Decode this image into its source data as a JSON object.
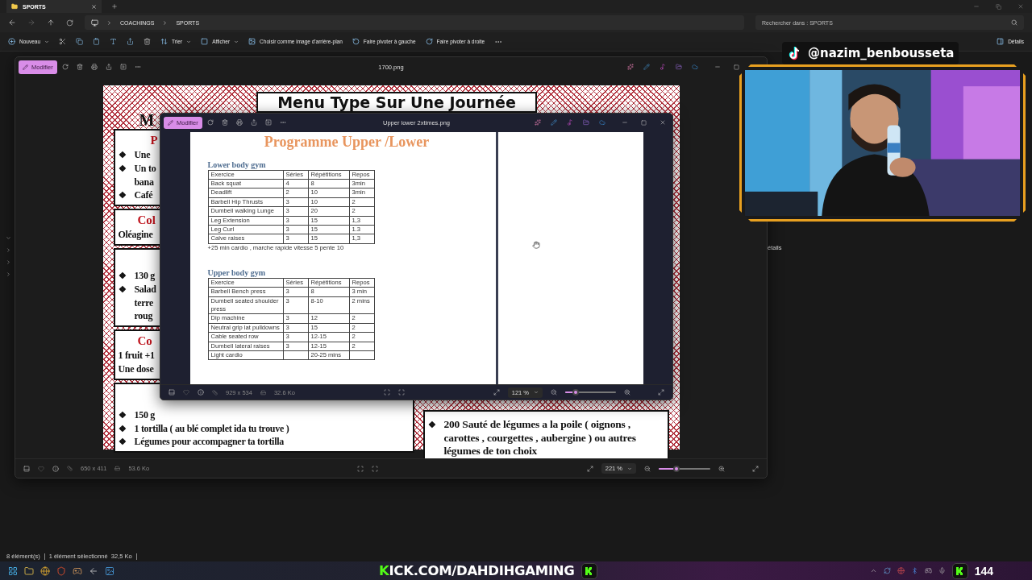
{
  "explorer": {
    "tab": {
      "title": "SPORTS"
    },
    "breadcrumb": [
      "COACHINGS",
      "SPORTS"
    ],
    "search": {
      "placeholder": "Rechercher dans : SPORTS"
    },
    "commands": [
      {
        "kind": "dropdown",
        "label": "Nouveau"
      },
      {
        "kind": "dropdown",
        "label": "Trier"
      },
      {
        "kind": "dropdown",
        "label": "Afficher"
      },
      {
        "kind": "action",
        "label": "Choisir comme image d'arrière-plan"
      },
      {
        "kind": "action",
        "label": "Faire pivoter à gauche"
      },
      {
        "kind": "action",
        "label": "Faire pivoter à droite"
      }
    ],
    "details_button": "Détails",
    "details_pane_fragment": "étails",
    "status_bar": {
      "item_count": "8 élément(s)",
      "selection": "1 élément sélectionné  32,5 Ko"
    }
  },
  "viewer_back": {
    "edit_button": "Modifier",
    "file_name": "1700.png",
    "dimensions": "650 x 411",
    "file_size": "53.6 Ko",
    "zoom": "221 %",
    "zoom_slider": {
      "level": 0.35
    },
    "menu_image": {
      "title": "Menu Type Sur Une Journée",
      "side_heading": "M",
      "cards": [
        {
          "lines": [
            {
              "kind": "heading",
              "text": "P"
            },
            {
              "kind": "bullet",
              "bullet": "❖",
              "text": "Une"
            },
            {
              "kind": "bullet",
              "bullet": "❖",
              "text": "Un to"
            },
            {
              "kind": "continuation",
              "text": "bana"
            },
            {
              "kind": "bullet",
              "bullet": "❖",
              "text": "Café"
            }
          ]
        },
        {
          "lines": [
            {
              "kind": "heading",
              "text": "Col"
            },
            {
              "kind": "plain",
              "text": "Oléagine"
            }
          ]
        },
        {
          "lines": [
            {
              "kind": "bullet",
              "bullet": "❖",
              "text": "130 g"
            },
            {
              "kind": "bullet",
              "bullet": "❖",
              "text": "Salad"
            },
            {
              "kind": "continuation",
              "text": "terre"
            },
            {
              "kind": "continuation",
              "text": "roug"
            }
          ]
        },
        {
          "lines": [
            {
              "kind": "heading",
              "text": "Co"
            },
            {
              "kind": "plain",
              "text": "1 fruit +1"
            },
            {
              "kind": "plain",
              "text": "Une dose"
            }
          ]
        },
        {
          "lines": [
            {
              "kind": "bullet",
              "bullet": "❖",
              "text": "150 g"
            },
            {
              "kind": "bullet",
              "bullet": "❖",
              "text": "1 tortilla ( au blé complet  ida tu trouve )"
            },
            {
              "kind": "bullet",
              "bullet": "❖",
              "text": "Légumes pour accompagner ta tortilla"
            }
          ]
        }
      ],
      "right_card": {
        "lines": [
          {
            "kind": "bullet",
            "bullet": "❖",
            "text": "200 Sauté de légumes a la poile ( oignons , carottes , courgettes , aubergine ) ou autres légumes de ton  choix"
          }
        ]
      }
    }
  },
  "viewer_front": {
    "edit_button": "Modifier",
    "file_name": "Upper lower 2xtimes.png",
    "dimensions": "929 x 534",
    "file_size": "32.6 Ko",
    "zoom": "121 %",
    "zoom_slider": {
      "level": 0.2
    },
    "document": {
      "title": "Programme Upper /Lower",
      "sections": [
        {
          "heading": "Lower body gym",
          "columns": [
            "Exercice",
            "Séries",
            "Répétitions",
            "Repos"
          ],
          "rows": [
            {
              "exercise": "Back squat",
              "sets": "4",
              "reps": "8",
              "rest": "3min"
            },
            {
              "exercise": "Deadlift",
              "sets": "2",
              "reps": "10",
              "rest": "3min"
            },
            {
              "exercise": "Barbell Hip Thrusts",
              "sets": "3",
              "reps": "10",
              "rest": "2"
            },
            {
              "exercise": "Dumbell walking Lunge",
              "sets": "3",
              "reps": "20",
              "rest": "2"
            },
            {
              "exercise": "Leg Extension",
              "sets": "3",
              "reps": "15",
              "rest": "1,3"
            },
            {
              "exercise": "Leg Curl",
              "sets": "3",
              "reps": "15",
              "rest": "1.3"
            },
            {
              "exercise": "Calve raises",
              "sets": "3",
              "reps": "15",
              "rest": "1,3"
            }
          ],
          "note": "+25 min cardio , marche rapide vitesse 5 pente 10"
        },
        {
          "heading": "Upper body gym",
          "columns": [
            "Exercice",
            "Séries",
            "Répétitions",
            "Repos"
          ],
          "rows": [
            {
              "exercise": "Barbell Bench press",
              "sets": "3",
              "reps": "8",
              "rest": "3 min"
            },
            {
              "exercise": "Dumbell seated shoulder press",
              "sets": "3",
              "reps": "8-10",
              "rest": "2 mins"
            },
            {
              "exercise": "Dip machine",
              "sets": "3",
              "reps": "12",
              "rest": "2"
            },
            {
              "exercise": "Neutral grip lat pulldowns",
              "sets": "3",
              "reps": "15",
              "rest": "2"
            },
            {
              "exercise": "Cable seated row",
              "sets": "3",
              "reps": "12-15",
              "rest": "2"
            },
            {
              "exercise": "Dumbell lateral raises",
              "sets": "3",
              "reps": "12-15",
              "rest": "2"
            },
            {
              "exercise": "Light cardio",
              "reps": "20-25 mins"
            }
          ]
        }
      ]
    }
  },
  "stream_overlay": {
    "tiktok_handle": "@nazim_benbousseta",
    "kick_url": "KICK.COM/DAHDIHGAMING",
    "viewer_count": "144"
  }
}
